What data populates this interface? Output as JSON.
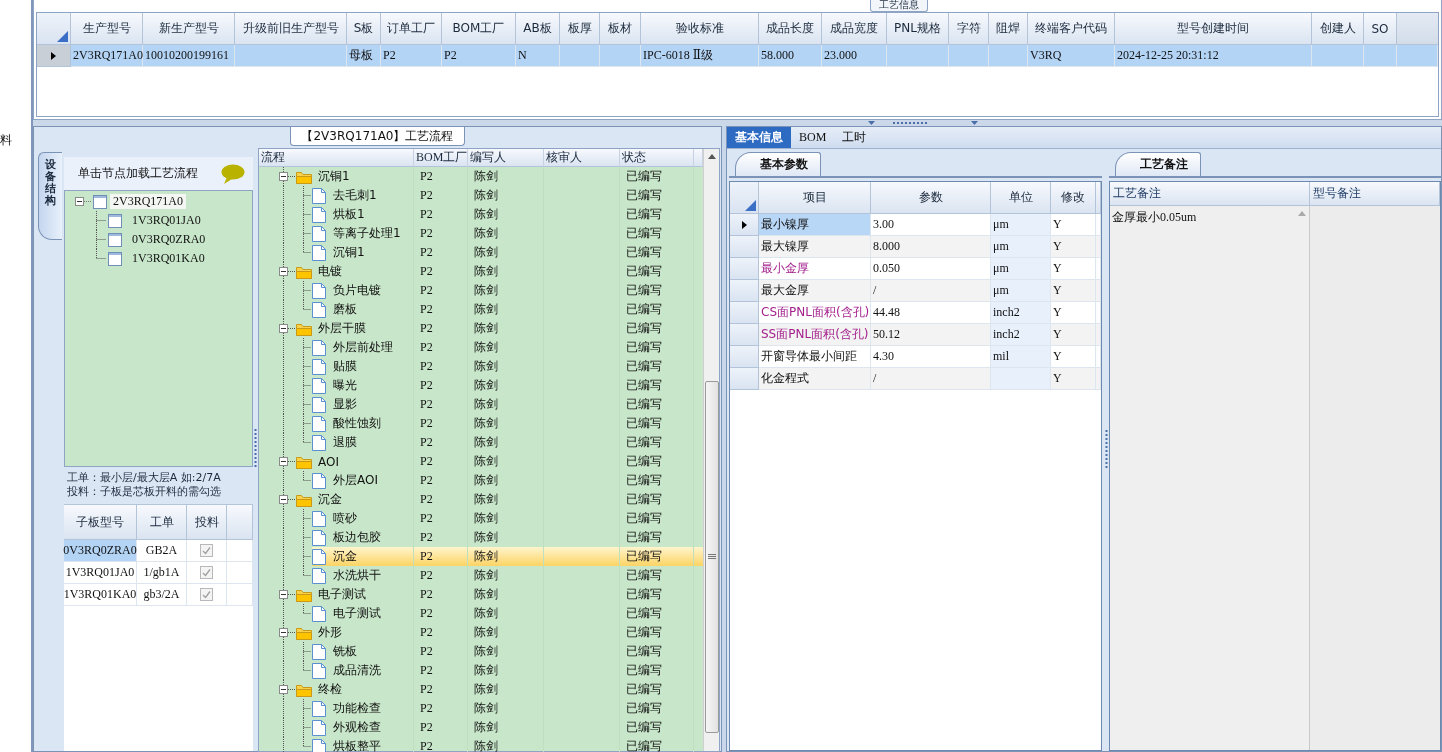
{
  "left_edge_text": "料",
  "top_panel": {
    "tab": "工艺信息",
    "grid": {
      "columns": [
        "生产型号",
        "新生产型号",
        "升级前旧生产型号",
        "S板",
        "订单工厂",
        "BOM工厂",
        "AB板",
        "板厚",
        "板材",
        "验收标准",
        "成品长度",
        "成品宽度",
        "PNL规格",
        "字符",
        "阻焊",
        "终端客户代码",
        "型号创建时间",
        "创建人",
        "SO"
      ],
      "rows": [
        {
          "selected": true,
          "cells": [
            "2V3RQ171A0",
            "10010200199161",
            null,
            "母板",
            "P2",
            "P2",
            "N",
            null,
            null,
            "IPC-6018 Ⅱ级",
            "58.000",
            "23.000",
            null,
            null,
            null,
            "V3RQ",
            "2024-12-25 20:31:12",
            null,
            null
          ]
        }
      ]
    }
  },
  "flow_panel": {
    "title": "【2V3RQ171A0】工艺流程",
    "side_tab": "设备结构",
    "nav_header": "单击节点加载工艺流程",
    "structure_tree": [
      {
        "label": "2V3RQ171A0",
        "selected": true,
        "expanded": true,
        "children": [
          {
            "label": "1V3RQ01JA0",
            "selected": false
          },
          {
            "label": "0V3RQ0ZRA0",
            "selected": false
          },
          {
            "label": "1V3RQ01KA0",
            "selected": false
          }
        ]
      }
    ],
    "note_lines": [
      "工单：最小层/最大层A 如:2/7A",
      "投料：子板是芯板开料的需勾选"
    ],
    "sub_boards": {
      "columns": [
        "子板型号",
        "工单",
        "投料"
      ],
      "rows": [
        {
          "model": "0V3RQ0ZRA0",
          "order": "GB2A",
          "checked": true,
          "selected": true
        },
        {
          "model": "1V3RQ01JA0",
          "order": "1/gb1A",
          "checked": true,
          "selected": false
        },
        {
          "model": "1V3RQ01KA0",
          "order": "gb3/2A",
          "checked": true,
          "selected": false
        }
      ]
    },
    "process": {
      "columns": [
        "流程",
        "BOM工厂",
        "编写人",
        "核审人",
        "状态"
      ],
      "rows": [
        {
          "label": "沉铜1",
          "bom": "P2",
          "writer": "陈剑",
          "status": "已编写",
          "expanded": true,
          "selected": false,
          "children": [
            {
              "label": "去毛刺1",
              "bom": "P2",
              "writer": "陈剑",
              "status": "已编写",
              "selected": false
            },
            {
              "label": "烘板1",
              "bom": "P2",
              "writer": "陈剑",
              "status": "已编写",
              "selected": false
            },
            {
              "label": "等离子处理1",
              "bom": "P2",
              "writer": "陈剑",
              "status": "已编写",
              "selected": false
            },
            {
              "label": "沉铜1",
              "bom": "P2",
              "writer": "陈剑",
              "status": "已编写",
              "selected": false
            }
          ]
        },
        {
          "label": "电镀",
          "bom": "P2",
          "writer": "陈剑",
          "status": "已编写",
          "expanded": true,
          "selected": false,
          "children": [
            {
              "label": "负片电镀",
              "bom": "P2",
              "writer": "陈剑",
              "status": "已编写",
              "selected": false
            },
            {
              "label": "磨板",
              "bom": "P2",
              "writer": "陈剑",
              "status": "已编写",
              "selected": false
            }
          ]
        },
        {
          "label": "外层干膜",
          "bom": "P2",
          "writer": "陈剑",
          "status": "已编写",
          "expanded": true,
          "selected": false,
          "children": [
            {
              "label": "外层前处理",
              "bom": "P2",
              "writer": "陈剑",
              "status": "已编写",
              "selected": false
            },
            {
              "label": "贴膜",
              "bom": "P2",
              "writer": "陈剑",
              "status": "已编写",
              "selected": false
            },
            {
              "label": "曝光",
              "bom": "P2",
              "writer": "陈剑",
              "status": "已编写",
              "selected": false
            },
            {
              "label": "显影",
              "bom": "P2",
              "writer": "陈剑",
              "status": "已编写",
              "selected": false
            },
            {
              "label": "酸性蚀刻",
              "bom": "P2",
              "writer": "陈剑",
              "status": "已编写",
              "selected": false
            },
            {
              "label": "退膜",
              "bom": "P2",
              "writer": "陈剑",
              "status": "已编写",
              "selected": false
            }
          ]
        },
        {
          "label": "AOI",
          "bom": "P2",
          "writer": "陈剑",
          "status": "已编写",
          "expanded": true,
          "selected": false,
          "children": [
            {
              "label": "外层AOI",
              "bom": "P2",
              "writer": "陈剑",
              "status": "已编写",
              "selected": false
            }
          ]
        },
        {
          "label": "沉金",
          "bom": "P2",
          "writer": "陈剑",
          "status": "已编写",
          "expanded": true,
          "selected": false,
          "children": [
            {
              "label": "喷砂",
              "bom": "P2",
              "writer": "陈剑",
              "status": "已编写",
              "selected": false
            },
            {
              "label": "板边包胶",
              "bom": "P2",
              "writer": "陈剑",
              "status": "已编写",
              "selected": false
            },
            {
              "label": "沉金",
              "bom": "P2",
              "writer": "陈剑",
              "status": "已编写",
              "selected": true
            },
            {
              "label": "水洗烘干",
              "bom": "P2",
              "writer": "陈剑",
              "status": "已编写",
              "selected": false
            }
          ]
        },
        {
          "label": "电子测试",
          "bom": "P2",
          "writer": "陈剑",
          "status": "已编写",
          "expanded": true,
          "selected": false,
          "children": [
            {
              "label": "电子测试",
              "bom": "P2",
              "writer": "陈剑",
              "status": "已编写",
              "selected": false
            }
          ]
        },
        {
          "label": "外形",
          "bom": "P2",
          "writer": "陈剑",
          "status": "已编写",
          "expanded": true,
          "selected": false,
          "children": [
            {
              "label": "铣板",
              "bom": "P2",
              "writer": "陈剑",
              "status": "已编写",
              "selected": false
            },
            {
              "label": "成品清洗",
              "bom": "P2",
              "writer": "陈剑",
              "status": "已编写",
              "selected": false
            }
          ]
        },
        {
          "label": "终检",
          "bom": "P2",
          "writer": "陈剑",
          "status": "已编写",
          "expanded": true,
          "selected": false,
          "children": [
            {
              "label": "功能检查",
              "bom": "P2",
              "writer": "陈剑",
              "status": "已编写",
              "selected": false
            },
            {
              "label": "外观检查",
              "bom": "P2",
              "writer": "陈剑",
              "status": "已编写",
              "selected": false
            },
            {
              "label": "烘板整平",
              "bom": "P2",
              "writer": "陈剑",
              "status": "已编写",
              "selected": false
            }
          ]
        }
      ]
    }
  },
  "detail_panel": {
    "tabs": [
      {
        "label": "基本信息",
        "selected": true
      },
      {
        "label": "BOM",
        "selected": false
      },
      {
        "label": "工时",
        "selected": false
      }
    ],
    "params": {
      "tab": "基本参数",
      "columns": [
        "项目",
        "参数",
        "单位",
        "修改"
      ],
      "rows": [
        {
          "item": "最小镍厚",
          "value": "3.00",
          "unit": "μm",
          "modified": "Y",
          "flagged": false,
          "selected": true
        },
        {
          "item": "最大镍厚",
          "value": "8.000",
          "unit": "μm",
          "modified": "Y",
          "flagged": false,
          "selected": false
        },
        {
          "item": "最小金厚",
          "value": "0.050",
          "unit": "μm",
          "modified": "Y",
          "flagged": true,
          "selected": false
        },
        {
          "item": "最大金厚",
          "value": "/",
          "unit": "μm",
          "modified": "Y",
          "flagged": false,
          "selected": false
        },
        {
          "item": "CS面PNL面积(含孔)",
          "value": "44.48",
          "unit": "inch2",
          "modified": "Y",
          "flagged": true,
          "selected": false
        },
        {
          "item": "SS面PNL面积(含孔)",
          "value": "50.12",
          "unit": "inch2",
          "modified": "Y",
          "flagged": true,
          "selected": false
        },
        {
          "item": "开窗导体最小间距",
          "value": "4.30",
          "unit": "mil",
          "modified": "Y",
          "flagged": false,
          "selected": false
        },
        {
          "item": "化金程式",
          "value": "/",
          "modified": "Y",
          "flagged": false,
          "selected": false
        }
      ]
    },
    "remarks": {
      "tab": "工艺备注",
      "columns": [
        "工艺备注",
        "型号备注"
      ],
      "process_remark": "金厚最小0.05um"
    }
  }
}
